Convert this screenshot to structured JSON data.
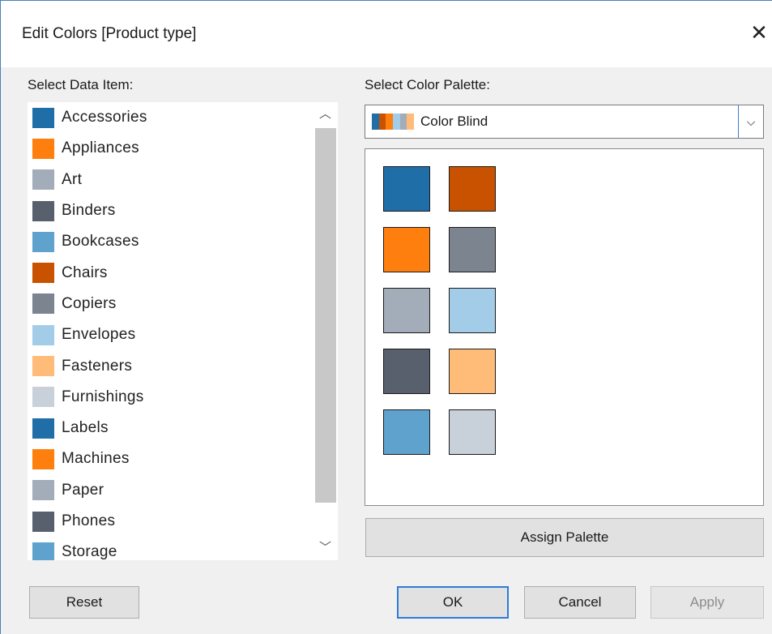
{
  "dialog": {
    "title": "Edit Colors [Product type]",
    "close_icon": "close-icon"
  },
  "data_items": {
    "label": "Select Data Item:",
    "items": [
      {
        "label": "Accessories",
        "color": "#1f6ea8"
      },
      {
        "label": "Appliances",
        "color": "#ff7f0e"
      },
      {
        "label": "Art",
        "color": "#a3acb9"
      },
      {
        "label": "Binders",
        "color": "#57606c"
      },
      {
        "label": "Bookcases",
        "color": "#5fa2ce"
      },
      {
        "label": "Chairs",
        "color": "#c85200"
      },
      {
        "label": "Copiers",
        "color": "#7b848f"
      },
      {
        "label": "Envelopes",
        "color": "#a3cce9"
      },
      {
        "label": "Fasteners",
        "color": "#ffbc79"
      },
      {
        "label": "Furnishings",
        "color": "#c8d0d9"
      },
      {
        "label": "Labels",
        "color": "#1f6ea8"
      },
      {
        "label": "Machines",
        "color": "#ff7f0e"
      },
      {
        "label": "Paper",
        "color": "#a3acb9"
      },
      {
        "label": "Phones",
        "color": "#57606c"
      },
      {
        "label": "Storage",
        "color": "#5fa2ce"
      }
    ],
    "scroll_up_icon": "chevron-up-icon",
    "scroll_down_icon": "chevron-down-icon"
  },
  "palette": {
    "label": "Select Color Palette:",
    "selected": "Color Blind",
    "preview_colors": [
      "#1f6ea8",
      "#c85200",
      "#ff7f0e",
      "#a3cce9",
      "#a3acb9",
      "#ffbc79"
    ],
    "swatches": [
      "#1f6ea8",
      "#c85200",
      "#ff7f0e",
      "#7b848f",
      "#a3acb9",
      "#a3cce9",
      "#57606c",
      "#ffbc79",
      "#5fa2ce",
      "#c8d0d9"
    ],
    "assign_label": "Assign Palette"
  },
  "buttons": {
    "reset": "Reset",
    "ok": "OK",
    "cancel": "Cancel",
    "apply": "Apply"
  }
}
